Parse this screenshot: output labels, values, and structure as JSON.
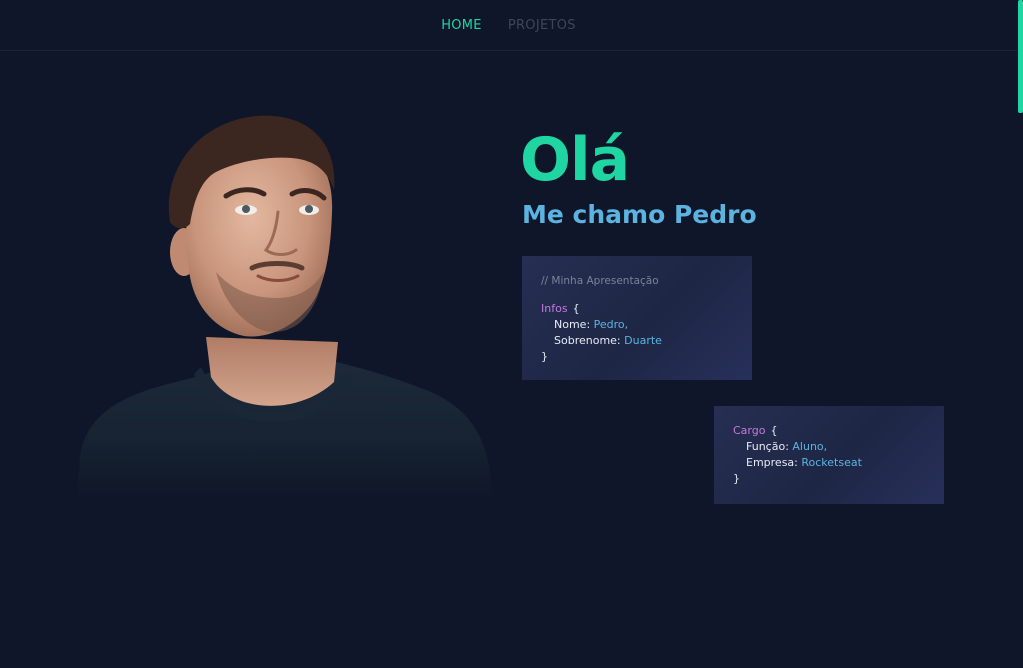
{
  "nav": {
    "items": [
      {
        "label": "HOME",
        "active": true
      },
      {
        "label": "PROJETOS",
        "active": false
      }
    ]
  },
  "hero": {
    "greeting": "Olá",
    "subtitle": "Me chamo Pedro"
  },
  "card_intro": {
    "comment": "// Minha Apresentação",
    "object_name": "Infos",
    "open_brace": "{",
    "close_brace": "}",
    "fields": [
      {
        "key": "Nome:",
        "value": "Pedro,"
      },
      {
        "key": "Sobrenome:",
        "value": "Duarte"
      }
    ]
  },
  "card_job": {
    "object_name": "Cargo",
    "open_brace": "{",
    "close_brace": "}",
    "fields": [
      {
        "key": "Função:",
        "value": "Aluno,"
      },
      {
        "key": "Empresa:",
        "value": "Rocketseat"
      }
    ]
  },
  "colors": {
    "background": "#0f1629",
    "accent": "#1fd6a3",
    "subtitle": "#5cb3e0",
    "code_keyword": "#c678dd",
    "card": "#232c4d"
  },
  "icons": {
    "portrait": "person-portrait-image"
  }
}
